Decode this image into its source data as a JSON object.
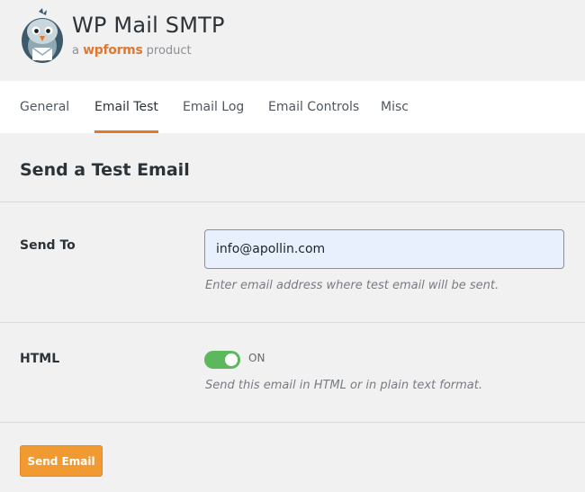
{
  "brand": {
    "title": "WP Mail SMTP",
    "sub_prefix": "a",
    "sub_brand": "wpforms",
    "sub_suffix": "product",
    "accent_color": "#e27730"
  },
  "nav": {
    "tabs": [
      {
        "label": "General",
        "active": false
      },
      {
        "label": "Email Test",
        "active": true
      },
      {
        "label": "Email Log",
        "active": false
      },
      {
        "label": "Email Controls",
        "active": false
      },
      {
        "label": "Misc",
        "active": false
      }
    ]
  },
  "section": {
    "title": "Send a Test Email"
  },
  "send_to": {
    "label": "Send To",
    "value": "info@apollin.com",
    "help": "Enter email address where test email will be sent."
  },
  "html_option": {
    "label": "HTML",
    "state": "ON",
    "enabled": true,
    "toggle_color": "#5cb85c",
    "help": "Send this email in HTML or in plain text format."
  },
  "actions": {
    "send_label": "Send Email",
    "button_color": "#f29a32"
  },
  "icons": {
    "logo": "pigeon-logo-icon"
  }
}
